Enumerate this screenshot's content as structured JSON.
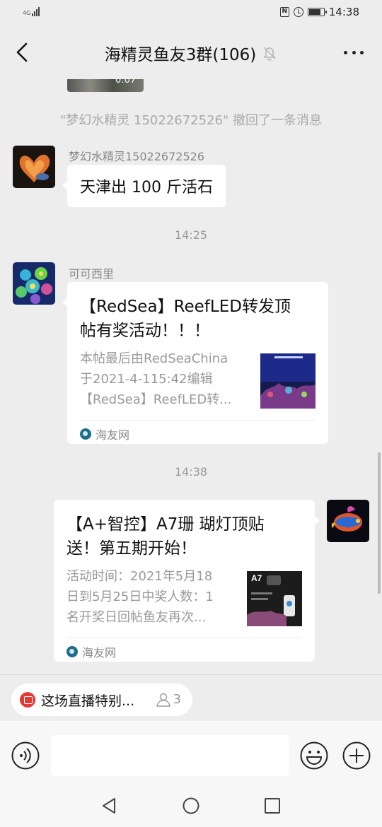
{
  "status_bar": {
    "network": "4G",
    "time": "14:38"
  },
  "header": {
    "title": "海精灵鱼友3群(106)"
  },
  "chat": {
    "video_duration": "0:07",
    "recall_notice": "\"梦幻水精灵 15022672526\" 撤回了一条消息",
    "messages": [
      {
        "sender": "梦幻水精灵15022672526",
        "text": "天津出 100 斤活石"
      },
      {
        "time": "14:25",
        "sender": "可可西里",
        "card": {
          "title_line1": "【RedSea】ReefLED转发顶",
          "title_line2": "帖有奖活动！！！",
          "desc_line1": "本帖最后由RedSeaChina",
          "desc_line2": "于2021-4-115:42编辑",
          "desc_line3": "【RedSea】ReefLED转...",
          "source": "海友网"
        }
      },
      {
        "time": "14:38",
        "card": {
          "title_line1": "【A+智控】A7珊 瑚灯顶贴",
          "title_line2": "送！第五期开始！",
          "desc_line1": "活动时间：2021年5月18",
          "desc_line2": "日到5月25日中奖人数：1",
          "desc_line3": "名开奖日回帖鱼友再次...",
          "thumb_label": "A7",
          "source": "海友网"
        }
      }
    ]
  },
  "live_bar": {
    "text": "这场直播特别...",
    "count": "3"
  },
  "input": {
    "placeholder": ""
  }
}
